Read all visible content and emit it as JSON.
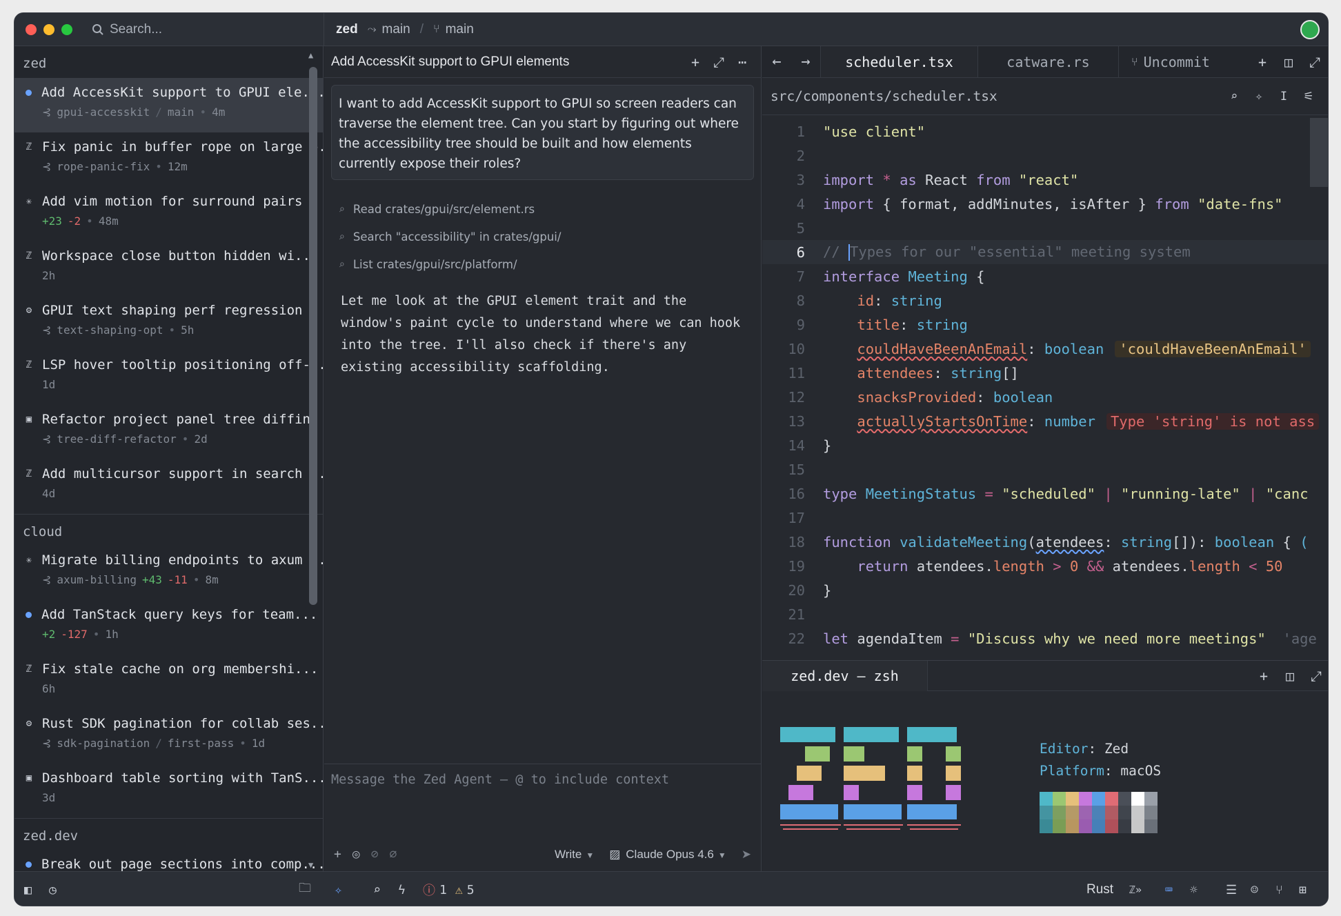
{
  "titlebar": {
    "search_placeholder": "Search...",
    "project": "zed",
    "branch1": "main",
    "branch2": "main"
  },
  "sidebar": {
    "groups": [
      {
        "label": "zed"
      },
      {
        "label": "cloud"
      },
      {
        "label": "zed.dev"
      }
    ],
    "threads": [
      {
        "icon": "dot",
        "title": "Add AccessKit support to GPUI ele...",
        "branch": "gpui-accesskit",
        "base": "main",
        "time": "4m"
      },
      {
        "icon": "z",
        "title": "Fix panic in buffer rope on large p...",
        "branch": "rope-panic-fix",
        "time": "12m"
      },
      {
        "icon": "asterisk",
        "title": "Add vim motion for surround pairs",
        "added": "+23",
        "removed": "-2",
        "time": "48m"
      },
      {
        "icon": "z",
        "title": "Workspace close button hidden wi...",
        "time": "2h"
      },
      {
        "icon": "openai",
        "title": "GPUI text shaping perf regression",
        "branch": "text-shaping-opt",
        "time": "5h"
      },
      {
        "icon": "z",
        "title": "LSP hover tooltip positioning off-s...",
        "time": "1d"
      },
      {
        "icon": "square",
        "title": "Refactor project panel tree diffing",
        "branch": "tree-diff-refactor",
        "time": "2d"
      },
      {
        "icon": "z",
        "title": "Add multicursor support in search ...",
        "time": "4d"
      },
      {
        "icon": "asterisk",
        "title": "Migrate billing endpoints to axum ...",
        "branch": "axum-billing",
        "added": "+43",
        "removed": "-11",
        "time": "8m"
      },
      {
        "icon": "dot",
        "title": "Add TanStack query keys for team...",
        "added": "+2",
        "removed": "-127",
        "time": "1h"
      },
      {
        "icon": "z",
        "title": "Fix stale cache on org membershi...",
        "time": "6h"
      },
      {
        "icon": "openai",
        "title": "Rust SDK pagination for collab ses...",
        "branch": "sdk-pagination",
        "base": "first-pass",
        "time": "1d"
      },
      {
        "icon": "square",
        "title": "Dashboard table sorting with TanS...",
        "time": "3d"
      },
      {
        "icon": "dot",
        "title": "Break out page sections into comp..."
      }
    ]
  },
  "agent": {
    "title": "Add AccessKit support to GPUI elements",
    "user_message": "I want to add AccessKit support to GPUI so screen readers can traverse the element tree. Can you start by figuring out where the accessibility tree should be built and how elements currently expose their roles?",
    "tool_calls": [
      "Read crates/gpui/src/element.rs",
      "Search \"accessibility\" in crates/gpui/",
      "List crates/gpui/src/platform/"
    ],
    "reply": "Let me look at the GPUI element trait and the window's paint cycle to understand where we can hook into the tree. I'll also check if there's any existing accessibility scaffolding.",
    "composer_placeholder": "Message the Zed Agent — @ to include context",
    "mode": "Write",
    "model": "Claude Opus 4.6"
  },
  "editor": {
    "tabs": [
      "scheduler.tsx",
      "catware.rs",
      "Uncommit"
    ],
    "path": "src/components/scheduler.tsx",
    "line_numbers": [
      "1",
      "2",
      "3",
      "4",
      "5",
      "6",
      "7",
      "8",
      "9",
      "10",
      "11",
      "12",
      "13",
      "14",
      "15",
      "16",
      "17",
      "18",
      "19",
      "20",
      "21",
      "22"
    ],
    "hint_10": "'couldHaveBeenAnEmail'",
    "error_13": "Type 'string' is not ass"
  },
  "terminal": {
    "tab": "zed.dev — zsh",
    "editor_key": "Editor",
    "editor_val": "Zed",
    "platform_key": "Platform",
    "platform_val": "macOS",
    "palette_top": [
      "#4fb8c8",
      "#9bc772",
      "#e6c07b",
      "#c678dd",
      "#5aa0e6",
      "#e06c75",
      "#4a4f58",
      "#ffffff",
      "#9aa0a9"
    ],
    "palette_bottom": [
      "#3a8a96",
      "#7a9d55",
      "#b89660",
      "#9a5cb0",
      "#4680b8",
      "#b0505a",
      "#383c44",
      "#c8c8c8",
      "#6a7079"
    ]
  },
  "statusbar": {
    "errors": "1",
    "warnings": "5",
    "language": "Rust"
  },
  "colors": {
    "accent": "#6aa3ff",
    "added": "#5fba6e",
    "removed": "#e06a6a"
  }
}
